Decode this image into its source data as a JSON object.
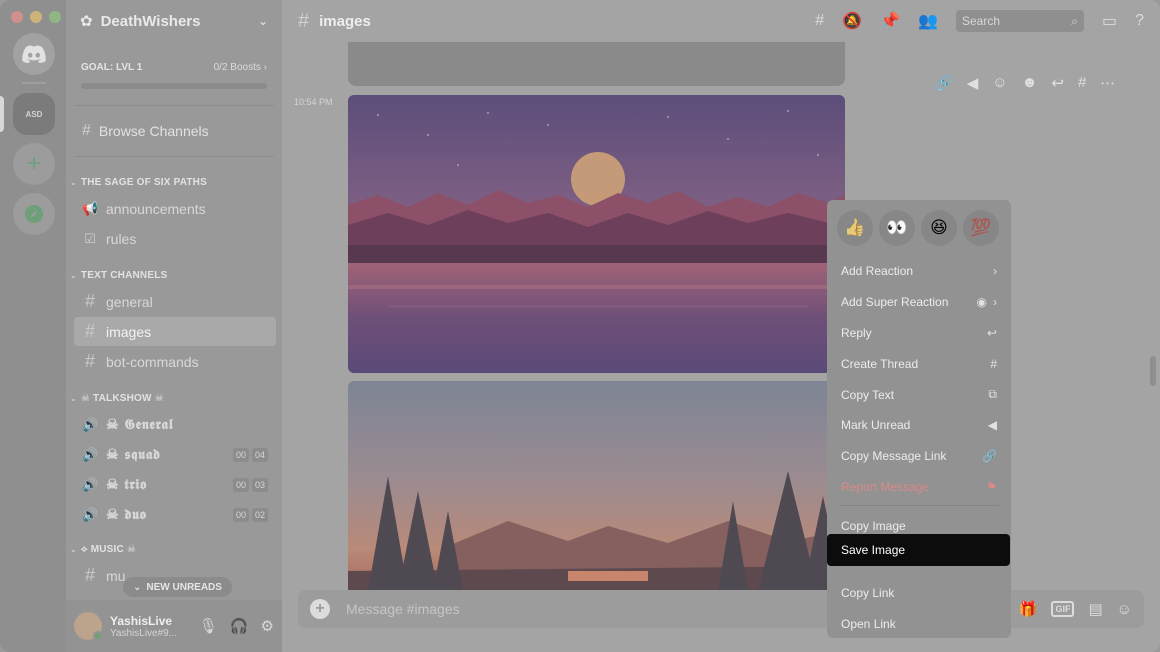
{
  "server": {
    "name": "DeathWishers",
    "rail_badge": "ASD",
    "goal_label": "GOAL: LVL 1",
    "boosts": "0/2 Boosts",
    "browse_label": "Browse Channels"
  },
  "categories": {
    "sage": "THE SAGE OF SIX PATHS",
    "text": "TEXT CHANNELS",
    "talkshow": "☠ TALKSHOW ☠",
    "music": "⟡ MUSIC ☠"
  },
  "channels": {
    "announcements": "announcements",
    "rules": "rules",
    "general": "general",
    "images": "images",
    "bot_commands": "bot-commands",
    "music_partial": "mu"
  },
  "voice": [
    {
      "name": "☠ 𝕲𝖊𝖓𝖊𝖗𝖆𝖑",
      "c1": "",
      "c2": ""
    },
    {
      "name": "☠ 𝖘𝖖𝖚𝖆𝖉",
      "c1": "00",
      "c2": "04"
    },
    {
      "name": "☠ 𝖙𝖗𝖎𝖔",
      "c1": "00",
      "c2": "03"
    },
    {
      "name": "☠ 𝖉𝖚𝖔",
      "c1": "00",
      "c2": "02"
    }
  ],
  "new_unreads": "NEW UNREADS",
  "user": {
    "name": "YashisLive",
    "tag": "YashisLive#9..."
  },
  "header": {
    "channel": "images",
    "search_placeholder": "Search"
  },
  "message": {
    "timestamp": "10:54 PM"
  },
  "composer": {
    "placeholder": "Message #images",
    "gif_label": "GIF"
  },
  "context_menu": {
    "reactions": [
      "👍",
      "👀",
      "😆",
      "💯"
    ],
    "items": [
      {
        "label": "Add Reaction",
        "icon": "›"
      },
      {
        "label": "Add Super Reaction",
        "icon": "›"
      },
      {
        "label": "Reply",
        "icon": "↩"
      },
      {
        "label": "Create Thread",
        "icon": "#"
      },
      {
        "label": "Copy Text",
        "icon": "⧉"
      },
      {
        "label": "Mark Unread",
        "icon": "◀"
      },
      {
        "label": "Copy Message Link",
        "icon": "🔗"
      },
      {
        "label": "Report Message",
        "icon": "⚑"
      }
    ],
    "items2": [
      {
        "label": "Copy Image"
      },
      {
        "label": "Save Image"
      },
      {
        "label": "Copy Link"
      },
      {
        "label": "Open Link"
      }
    ]
  }
}
